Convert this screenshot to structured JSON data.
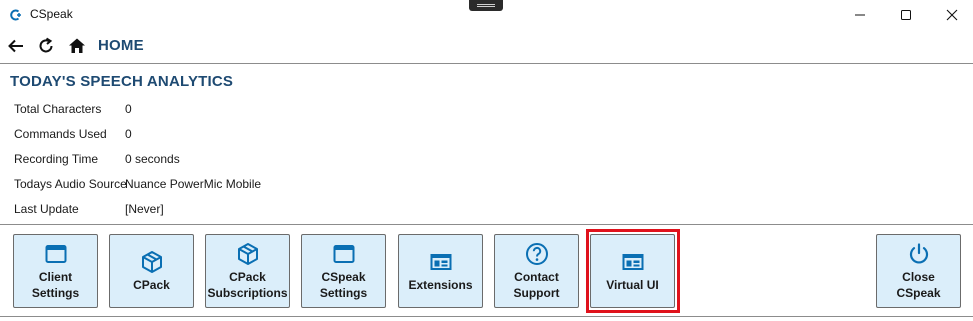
{
  "window": {
    "title": "CSpeak",
    "controls": [
      "minimize",
      "maximize",
      "close"
    ]
  },
  "nav": {
    "title": "HOME",
    "icons": [
      "back-arrow-icon",
      "refresh-icon",
      "home-icon"
    ]
  },
  "analytics": {
    "title": "TODAY'S SPEECH ANALYTICS",
    "rows": [
      {
        "label": "Total Characters",
        "value": "0"
      },
      {
        "label": "Commands Used",
        "value": "0"
      },
      {
        "label": "Recording Time",
        "value": "0 seconds"
      },
      {
        "label": "Todays Audio Source",
        "value": "Nuance PowerMic Mobile"
      },
      {
        "label": "Last Update",
        "value": "[Never]"
      }
    ]
  },
  "actions": {
    "client_settings": {
      "label": "Client Settings",
      "icon": "window-icon"
    },
    "cpack": {
      "label": "CPack",
      "icon": "package-icon"
    },
    "cpack_subscriptions": {
      "label": "CPack\nSubscriptions",
      "icon": "package-icon"
    },
    "cspeak_settings": {
      "label": "CSpeak\nSettings",
      "icon": "window-icon"
    },
    "extensions": {
      "label": "Extensions",
      "icon": "layout-icon"
    },
    "contact_support": {
      "label": "Contact\nSupport",
      "icon": "question-icon"
    },
    "virtual_ui": {
      "label": "Virtual UI",
      "icon": "layout-icon"
    },
    "close_cspeak": {
      "label": "Close\nCSpeak",
      "icon": "power-icon"
    }
  },
  "colors": {
    "accent": "#1e4a72",
    "icon_blue": "#0a6fb3",
    "button_bg": "#dbeefa",
    "highlight": "#e0121c"
  }
}
